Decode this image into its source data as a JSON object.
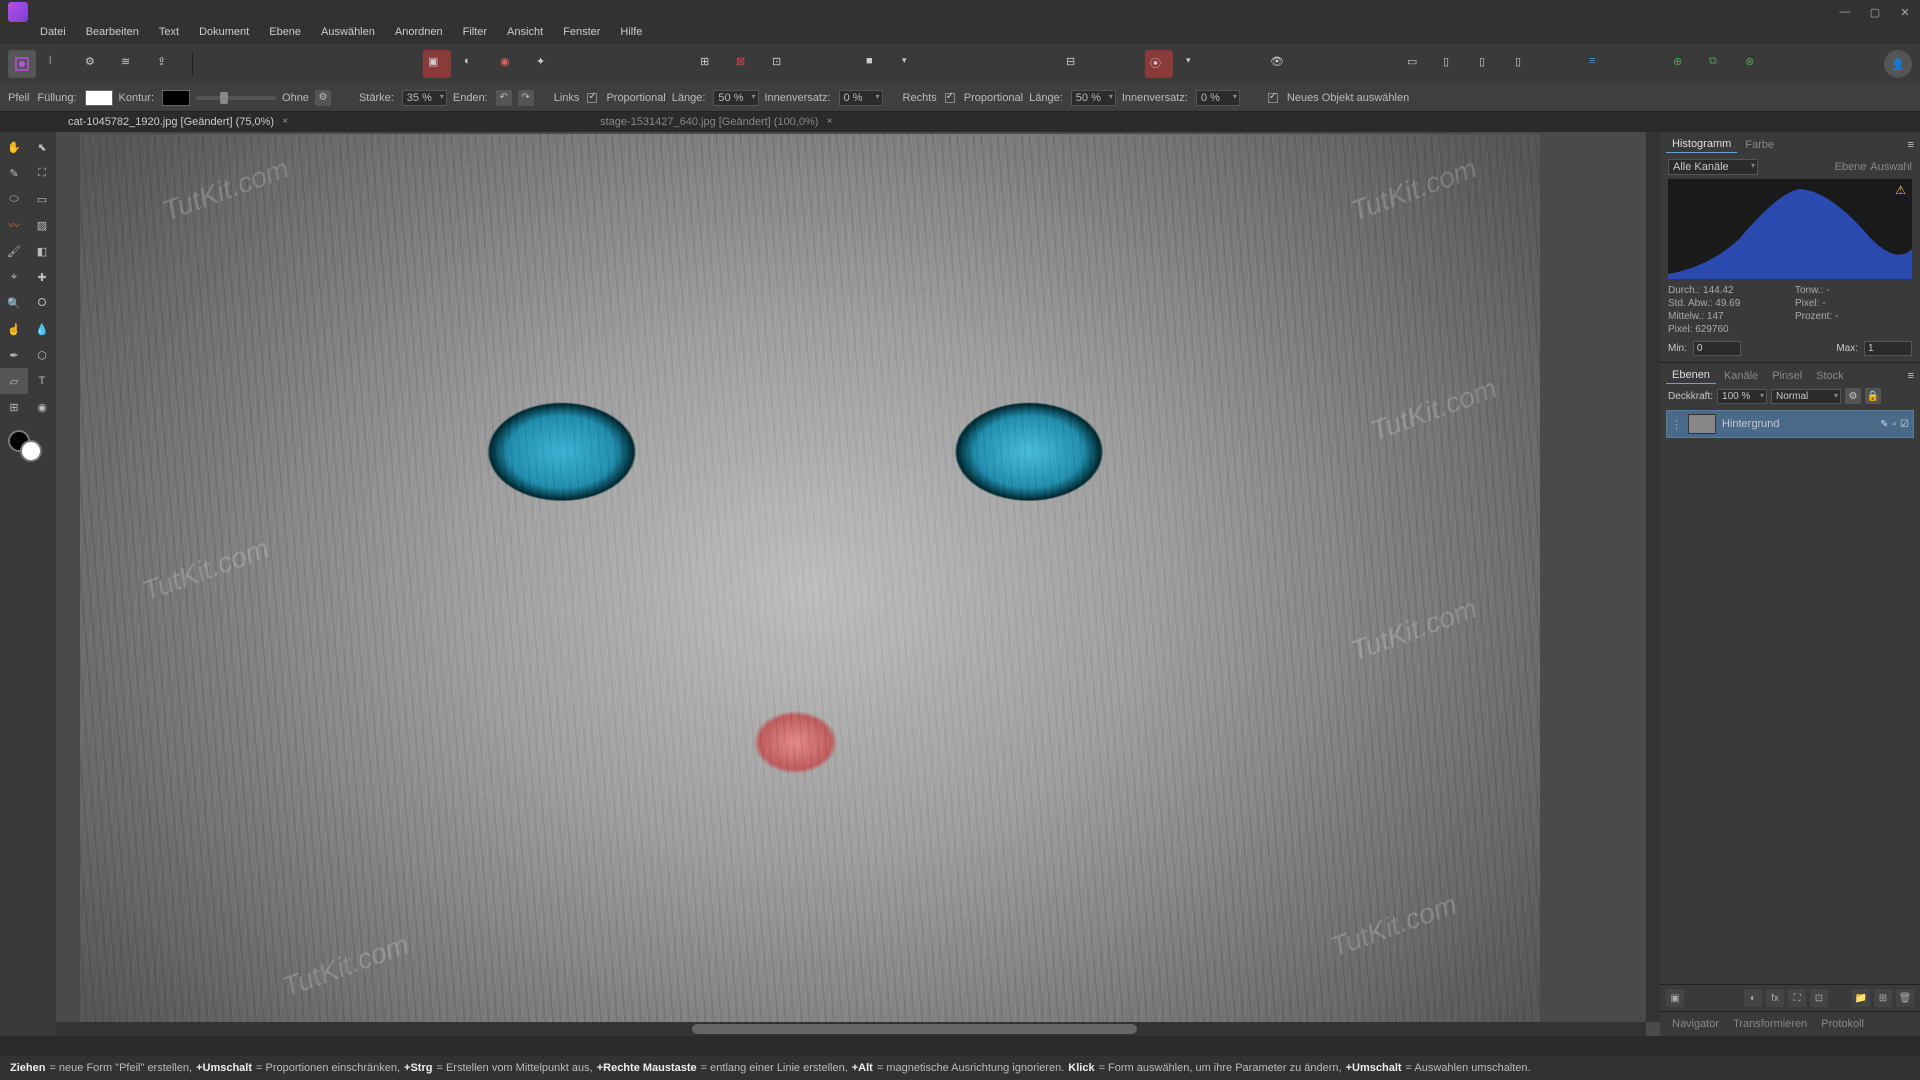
{
  "menu": [
    "Datei",
    "Bearbeiten",
    "Text",
    "Dokument",
    "Ebene",
    "Auswählen",
    "Anordnen",
    "Filter",
    "Ansicht",
    "Fenster",
    "Hilfe"
  ],
  "doctabs": [
    {
      "label": "cat-1045782_1920.jpg [Geändert] (75,0%)",
      "active": true
    },
    {
      "label": "stage-1531427_640.jpg [Geändert] (100,0%)",
      "active": false
    }
  ],
  "ctx": {
    "tool": "Pfeil",
    "fill": "Füllung:",
    "stroke": "Kontur:",
    "none": "Ohne",
    "strength": "Stärke:",
    "strength_v": "35 %",
    "ends": "Enden:",
    "left": "Links",
    "prop": "Proportional",
    "length": "Länge:",
    "length_v": "50 %",
    "inset": "Innenversatz:",
    "inset_v": "0 %",
    "right": "Rechts",
    "length2_v": "50 %",
    "inset2_v": "0 %",
    "newobj": "Neues Objekt auswählen"
  },
  "histogram": {
    "tab1": "Histogramm",
    "tab2": "Farbe",
    "channels": "Alle Kanäle",
    "ebene": "Ebene",
    "auswahl": "Auswahl",
    "stats": {
      "durch": "Durch.: 144.42",
      "tonw": "Tonw.: -",
      "std": "Std. Abw.: 49.69",
      "pixel_r": "Pixel: -",
      "mittelw": "Mittelw.: 147",
      "prozent": "Prozent: -",
      "pixel": "Pixel: 629760"
    },
    "min_l": "Min:",
    "min_v": "0",
    "max_l": "Max:",
    "max_v": "1"
  },
  "layers": {
    "tabs": [
      "Ebenen",
      "Kanäle",
      "Pinsel",
      "Stock"
    ],
    "opacity_l": "Deckkraft:",
    "opacity_v": "100 %",
    "blend": "Normal",
    "layer0": "Hintergrund"
  },
  "bottom_tabs": [
    "Navigator",
    "Transformieren",
    "Protokoll"
  ],
  "status": {
    "s1": "Ziehen",
    "t1": " = neue Form \"Pfeil\" erstellen, ",
    "s2": "+Umschalt",
    "t2": " = Proportionen einschränken, ",
    "s3": "+Strg",
    "t3": " = Erstellen vom Mittelpunkt aus, ",
    "s4": "+Rechte Maustaste",
    "t4": " = entlang einer Linie erstellen, ",
    "s5": "+Alt",
    "t5": " = magnetische Ausrichtung ignorieren. ",
    "s6": "Klick",
    "t6": " = Form auswählen, um ihre Parameter zu ändern, ",
    "s7": "+Umschalt",
    "t7": " = Auswahlen umschalten."
  },
  "watermark": "TutKit.com"
}
